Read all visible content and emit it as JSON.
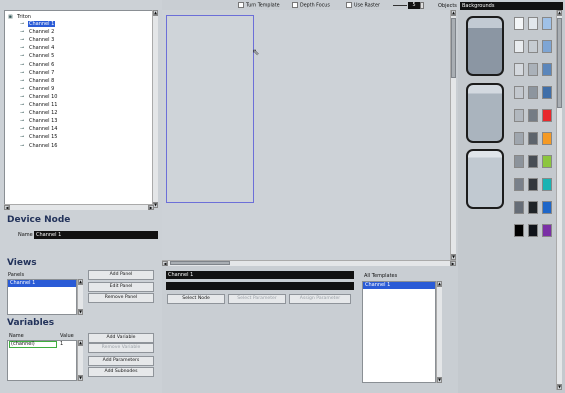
{
  "toolbar": {
    "turn_template": "Turn Template",
    "depth_focus": "Depth Focus",
    "use_raster": "Use Raster",
    "raster_value": "5",
    "objects_label": "Objects",
    "objects_value": "Backgrounds"
  },
  "tree": {
    "root": "Triton",
    "selected": "Channel 1",
    "channels": [
      "Channel 1",
      "Channel 2",
      "Channel 3",
      "Channel 4",
      "Channel 5",
      "Channel 6",
      "Channel 7",
      "Channel 8",
      "Channel 9",
      "Channel 10",
      "Channel 11",
      "Channel 12",
      "Channel 13",
      "Channel 14",
      "Channel 15",
      "Channel 16"
    ]
  },
  "device_node": {
    "title": "Device Node",
    "name_label": "Name",
    "name_value": "Channel 1"
  },
  "views": {
    "title": "Views",
    "panels_label": "Panels",
    "panel_items": [
      "Channel 1"
    ],
    "add_panel": "Add Panel",
    "edit_panel": "Edit Panel",
    "remove_panel": "Remove Panel"
  },
  "variables": {
    "title": "Variables",
    "col_name": "Name",
    "col_value": "Value",
    "row_name": "(channel)",
    "row_value": "1",
    "add_variable": "Add Variable",
    "remove_variable": "Remove Variable",
    "add_parameters": "Add Parameters",
    "add_subnodes": "Add Subnodes"
  },
  "bottom_center": {
    "name_field": "Channel 1",
    "select_node": "Select Node",
    "select_parameter": "Select Parameter",
    "assign_parameter": "Assign Parameter"
  },
  "templates": {
    "title": "All Templates",
    "items": [
      "Channel 1"
    ]
  },
  "swatches": {
    "rows": [
      [
        "#f4f6f8",
        "#e2e7ec",
        "#9fc1e8"
      ],
      [
        "#e9ecef",
        "#c6ccd2",
        "#7ea5d4"
      ],
      [
        "#d5d9de",
        "#aab1b9",
        "#5b86bb"
      ],
      [
        "#c3c8ce",
        "#8d959e",
        "#3f6ea8"
      ],
      [
        "#b2b8bf",
        "#747c85",
        "#e8282c"
      ],
      [
        "#9fa6ae",
        "#5d646c",
        "#f59a25"
      ],
      [
        "#8c939b",
        "#474d54",
        "#8cc63f"
      ],
      [
        "#79808a",
        "#32373d",
        "#19b3b3"
      ],
      [
        "#666d77",
        "#1f2327",
        "#1e66c8"
      ],
      [
        "#000000",
        "#10131a",
        "#7a2fa6"
      ]
    ]
  }
}
